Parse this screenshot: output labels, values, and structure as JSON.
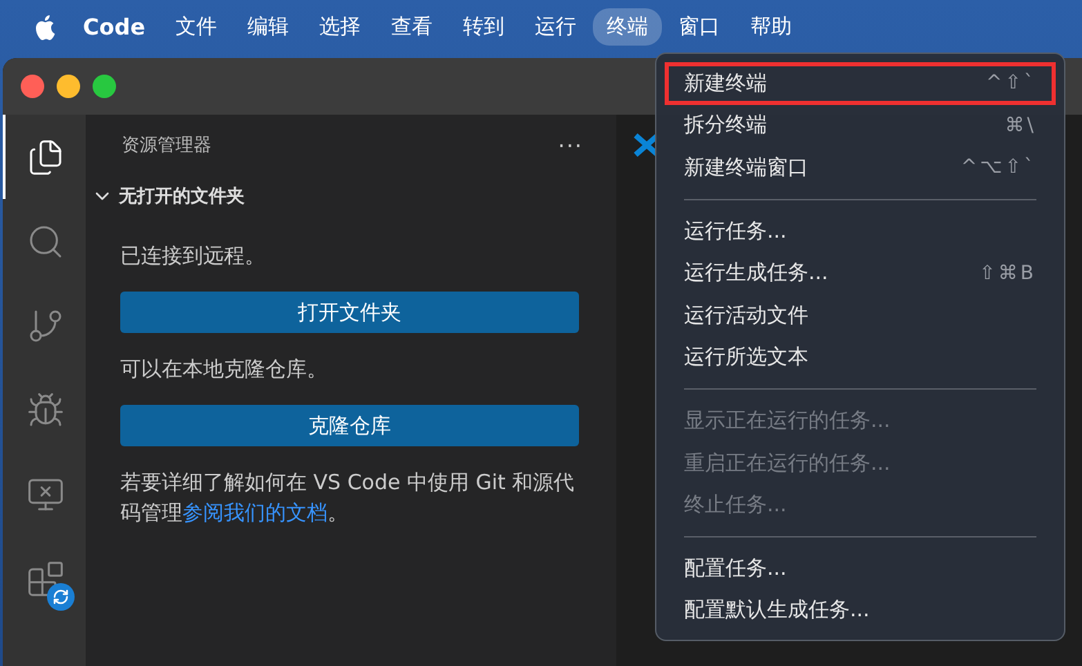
{
  "menu_bar": {
    "app": "Code",
    "items": [
      {
        "label": "文件",
        "selected": false
      },
      {
        "label": "编辑",
        "selected": false
      },
      {
        "label": "选择",
        "selected": false
      },
      {
        "label": "查看",
        "selected": false
      },
      {
        "label": "转到",
        "selected": false
      },
      {
        "label": "运行",
        "selected": false
      },
      {
        "label": "终端",
        "selected": true
      },
      {
        "label": "窗口",
        "selected": false
      },
      {
        "label": "帮助",
        "selected": false
      }
    ]
  },
  "activity_bar": [
    {
      "kind": "files",
      "selected": true
    },
    {
      "kind": "search",
      "selected": false
    },
    {
      "kind": "source-control",
      "selected": false
    },
    {
      "kind": "debug",
      "selected": false
    },
    {
      "kind": "remote",
      "selected": false
    },
    {
      "kind": "extensions",
      "selected": false
    }
  ],
  "sidebar": {
    "title": "资源管理器",
    "more": "···",
    "section": {
      "title": "无打开的文件夹",
      "expanded": true
    },
    "content": [
      {
        "kind": "text",
        "text": "已连接到远程。"
      },
      {
        "kind": "button",
        "text": "打开文件夹"
      },
      {
        "kind": "text",
        "text": "可以在本地克隆仓库。"
      },
      {
        "kind": "button",
        "text": "克隆仓库"
      },
      {
        "kind": "text",
        "text": "若要详细了解如何在 VS Code 中使用 Git 和源代码管理",
        "link": "参阅我们的文档",
        "after": "。"
      }
    ]
  },
  "terminal_menu": [
    {
      "kind": "item",
      "label": "新建终端",
      "shortcut": "^⇧`",
      "disabled": false,
      "highlighted": true
    },
    {
      "kind": "item",
      "label": "拆分终端",
      "shortcut": "⌘\\",
      "disabled": false,
      "highlighted": false
    },
    {
      "kind": "item",
      "label": "新建终端窗口",
      "shortcut": "^⌥⇧`",
      "disabled": false,
      "highlighted": false
    },
    {
      "kind": "separator"
    },
    {
      "kind": "item",
      "label": "运行任务...",
      "disabled": false,
      "highlighted": false
    },
    {
      "kind": "item",
      "label": "运行生成任务...",
      "shortcut": "⇧⌘B",
      "disabled": false,
      "highlighted": false
    },
    {
      "kind": "item",
      "label": "运行活动文件",
      "disabled": false,
      "highlighted": false
    },
    {
      "kind": "item",
      "label": "运行所选文本",
      "disabled": false,
      "highlighted": false
    },
    {
      "kind": "separator"
    },
    {
      "kind": "item",
      "label": "显示正在运行的任务...",
      "disabled": true,
      "highlighted": false
    },
    {
      "kind": "item",
      "label": "重启正在运行的任务...",
      "disabled": true,
      "highlighted": false
    },
    {
      "kind": "item",
      "label": "终止任务...",
      "disabled": true,
      "highlighted": false
    },
    {
      "kind": "separator"
    },
    {
      "kind": "item",
      "label": "配置任务...",
      "disabled": false,
      "highlighted": false
    },
    {
      "kind": "item",
      "label": "配置默认生成任务...",
      "disabled": false,
      "highlighted": false
    }
  ]
}
